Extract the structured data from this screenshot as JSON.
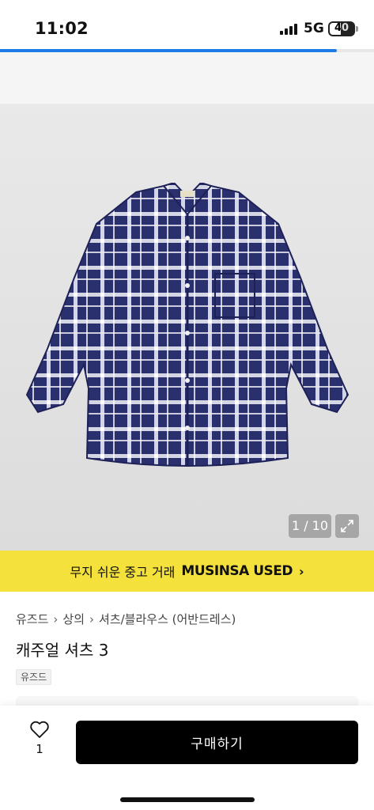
{
  "status_bar": {
    "time": "11:02",
    "network": "5G",
    "battery": "40"
  },
  "loading": {
    "progress_percent": 90
  },
  "gallery": {
    "page_indicator": "1 / 10"
  },
  "banner": {
    "text": "무지 쉬운 중고 거래",
    "brand": "MUSINSA USED",
    "chevron": "›"
  },
  "product": {
    "breadcrumb": [
      "유즈드",
      "상의",
      "셔츠/블라우스 (어반드레스)"
    ],
    "breadcrumb_separator": "›",
    "title": "캐주얼 셔츠 3",
    "brand_tag": "유즈드"
  },
  "bottom": {
    "like_count": "1",
    "buy_label": "구매하기"
  },
  "colors": {
    "accent_banner": "#f5e13c",
    "progress": "#1e7be6",
    "buy_button": "#000000",
    "shirt_navy": "#2a2f6e"
  },
  "icons": {
    "like": "heart-outline-icon",
    "expand": "expand-arrows-icon",
    "signal": "cell-signal-icon",
    "battery": "battery-icon"
  }
}
